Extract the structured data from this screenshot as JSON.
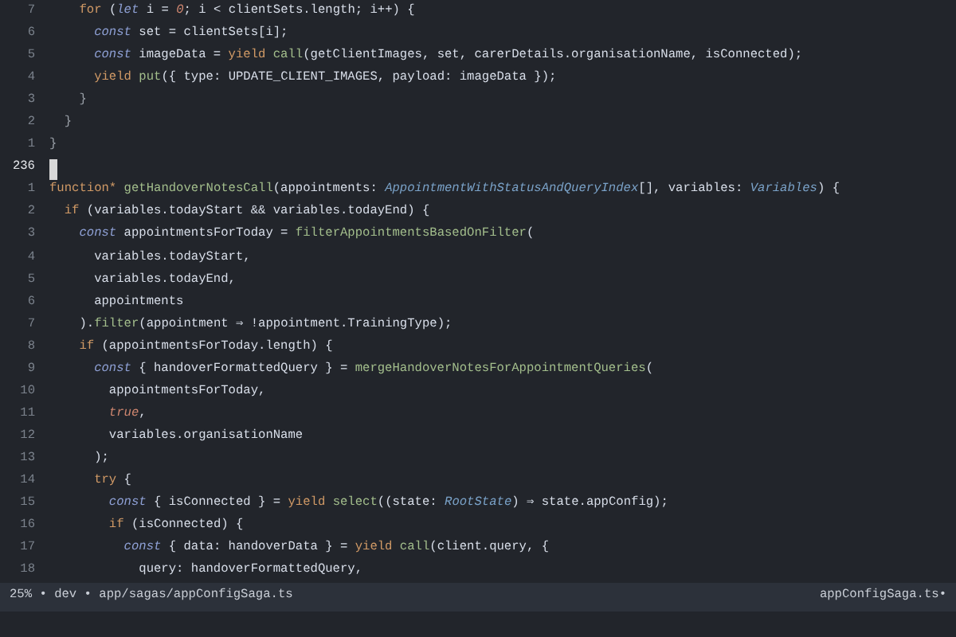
{
  "editor": {
    "lines": [
      {
        "number": "7",
        "current": false,
        "tokens": [
          {
            "kind": "keyword",
            "text": "    for"
          },
          {
            "kind": "plain",
            "text": " ("
          },
          {
            "kind": "storage",
            "text": "let"
          },
          {
            "kind": "plain",
            "text": " i = "
          },
          {
            "kind": "literal",
            "text": "0"
          },
          {
            "kind": "plain",
            "text": "; i < clientSets.length; i++) {"
          }
        ]
      },
      {
        "number": "6",
        "current": false,
        "tokens": [
          {
            "kind": "storage",
            "text": "      const"
          },
          {
            "kind": "plain",
            "text": " set = clientSets[i];"
          }
        ]
      },
      {
        "number": "5",
        "current": false,
        "tokens": [
          {
            "kind": "storage",
            "text": "      const"
          },
          {
            "kind": "plain",
            "text": " imageData = "
          },
          {
            "kind": "keyword",
            "text": "yield "
          },
          {
            "kind": "func",
            "text": "call"
          },
          {
            "kind": "plain",
            "text": "(getClientImages, set, carerDetails.organisationName, isConnected);"
          }
        ]
      },
      {
        "number": "4",
        "current": false,
        "tokens": [
          {
            "kind": "keyword",
            "text": "      yield "
          },
          {
            "kind": "func",
            "text": "put"
          },
          {
            "kind": "plain",
            "text": "({ type: UPDATE_CLIENT_IMAGES, payload: imageData });"
          }
        ]
      },
      {
        "number": "3",
        "current": false,
        "tokens": [
          {
            "kind": "punct",
            "text": "    }"
          }
        ]
      },
      {
        "number": "2",
        "current": false,
        "tokens": [
          {
            "kind": "punct",
            "text": "  }"
          }
        ]
      },
      {
        "number": "1",
        "current": false,
        "tokens": [
          {
            "kind": "punct",
            "text": "}"
          }
        ]
      },
      {
        "number": "236",
        "current": true
      },
      {
        "number": "1",
        "current": false,
        "tokens": [
          {
            "kind": "keyword",
            "text": "function* "
          },
          {
            "kind": "func",
            "text": "getHandoverNotesCall"
          },
          {
            "kind": "plain",
            "text": "(appointments: "
          },
          {
            "kind": "type",
            "text": "AppointmentWithStatusAndQueryIndex"
          },
          {
            "kind": "plain",
            "text": "[], variables: "
          },
          {
            "kind": "type",
            "text": "Variables"
          },
          {
            "kind": "plain",
            "text": ") {"
          }
        ]
      },
      {
        "number": "2",
        "current": false,
        "tokens": [
          {
            "kind": "keyword",
            "text": "  if"
          },
          {
            "kind": "plain",
            "text": " (variables.todayStart && variables.todayEnd) {"
          }
        ]
      },
      {
        "number": "3",
        "current": false,
        "tokens": [
          {
            "kind": "storage",
            "text": "    const"
          },
          {
            "kind": "plain",
            "text": " appointmentsForToday = "
          },
          {
            "kind": "func",
            "text": "filterAppointmentsBasedOnFilter"
          },
          {
            "kind": "plain",
            "text": "("
          }
        ]
      },
      {
        "number": "4",
        "current": false,
        "tokens": [
          {
            "kind": "plain",
            "text": "      variables.todayStart,"
          }
        ]
      },
      {
        "number": "5",
        "current": false,
        "tokens": [
          {
            "kind": "plain",
            "text": "      variables.todayEnd,"
          }
        ]
      },
      {
        "number": "6",
        "current": false,
        "tokens": [
          {
            "kind": "plain",
            "text": "      appointments"
          }
        ]
      },
      {
        "number": "7",
        "current": false,
        "tokens": [
          {
            "kind": "plain",
            "text": "    )."
          },
          {
            "kind": "func",
            "text": "filter"
          },
          {
            "kind": "plain",
            "text": "(appointment ⇒ !appointment.TrainingType);"
          }
        ]
      },
      {
        "number": "8",
        "current": false,
        "tokens": [
          {
            "kind": "keyword",
            "text": "    if"
          },
          {
            "kind": "plain",
            "text": " (appointmentsForToday.length) {"
          }
        ]
      },
      {
        "number": "9",
        "current": false,
        "tokens": [
          {
            "kind": "storage",
            "text": "      const"
          },
          {
            "kind": "plain",
            "text": " { handoverFormattedQuery } = "
          },
          {
            "kind": "func",
            "text": "mergeHandoverNotesForAppointmentQueries"
          },
          {
            "kind": "plain",
            "text": "("
          }
        ]
      },
      {
        "number": "10",
        "current": false,
        "tokens": [
          {
            "kind": "plain",
            "text": "        appointmentsForToday,"
          }
        ]
      },
      {
        "number": "11",
        "current": false,
        "tokens": [
          {
            "kind": "literal",
            "text": "        true"
          },
          {
            "kind": "plain",
            "text": ","
          }
        ]
      },
      {
        "number": "12",
        "current": false,
        "tokens": [
          {
            "kind": "plain",
            "text": "        variables.organisationName"
          }
        ]
      },
      {
        "number": "13",
        "current": false,
        "tokens": [
          {
            "kind": "plain",
            "text": "      );"
          }
        ]
      },
      {
        "number": "14",
        "current": false,
        "tokens": [
          {
            "kind": "keyword",
            "text": "      try"
          },
          {
            "kind": "plain",
            "text": " {"
          }
        ]
      },
      {
        "number": "15",
        "current": false,
        "tokens": [
          {
            "kind": "storage",
            "text": "        const"
          },
          {
            "kind": "plain",
            "text": " { isConnected } = "
          },
          {
            "kind": "keyword",
            "text": "yield "
          },
          {
            "kind": "func",
            "text": "select"
          },
          {
            "kind": "plain",
            "text": "((state: "
          },
          {
            "kind": "type",
            "text": "RootState"
          },
          {
            "kind": "plain",
            "text": ") ⇒ state.appConfig);"
          }
        ]
      },
      {
        "number": "16",
        "current": false,
        "tokens": [
          {
            "kind": "keyword",
            "text": "        if"
          },
          {
            "kind": "plain",
            "text": " (isConnected) {"
          }
        ]
      },
      {
        "number": "17",
        "current": false,
        "tokens": [
          {
            "kind": "storage",
            "text": "          const"
          },
          {
            "kind": "plain",
            "text": " { data: handoverData } = "
          },
          {
            "kind": "keyword",
            "text": "yield "
          },
          {
            "kind": "func",
            "text": "call"
          },
          {
            "kind": "plain",
            "text": "(client.query, {"
          }
        ]
      },
      {
        "number": "18",
        "current": false,
        "tokens": [
          {
            "kind": "plain",
            "text": "            query: handoverFormattedQuery,"
          }
        ]
      }
    ]
  },
  "status_bar": {
    "left": "25% • dev • app/sagas/appConfigSaga.ts",
    "right": "appConfigSaga.ts•"
  }
}
